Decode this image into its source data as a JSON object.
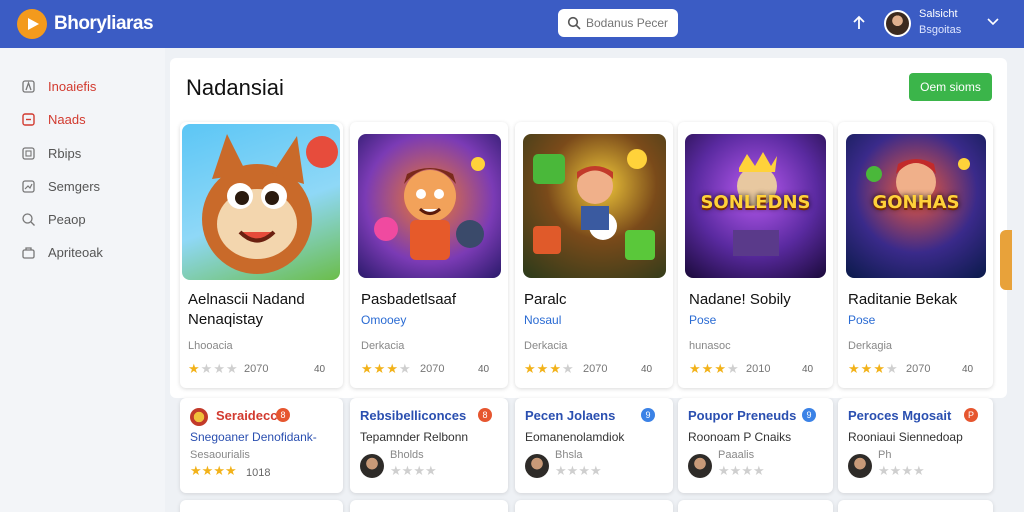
{
  "header": {
    "brand": "Bhoryliaras",
    "search_placeholder": "Bodanus Pecer",
    "user_name": "Salsicht",
    "user_sub": "Bsgoitas",
    "icons": [
      "play-logo-icon",
      "search-icon",
      "upload-icon",
      "chevron-down-icon"
    ]
  },
  "sidebar": {
    "items": [
      {
        "label": "Inoaiefis",
        "icon": "home-icon",
        "active": false
      },
      {
        "label": "Naads",
        "icon": "square-icon",
        "active": true
      },
      {
        "label": "Rbips",
        "icon": "grid-icon",
        "active": false
      },
      {
        "label": "Semgers",
        "icon": "chart-icon",
        "active": false
      },
      {
        "label": "Peaop",
        "icon": "search-icon",
        "active": false
      },
      {
        "label": "Apriteoak",
        "icon": "bag-icon",
        "active": false
      }
    ]
  },
  "main": {
    "title": "Nadansiai",
    "action_label": "Oem sioms",
    "cards": [
      {
        "title_line1": "Aelnascii Nadand",
        "title_line2": "Nenaqistay",
        "subtitle": "",
        "category": "Lhooacia",
        "rating": 1,
        "rating_text": "2070",
        "count": "40",
        "thumb_text": ""
      },
      {
        "title_line1": "Pasbadetlsaaf",
        "title_line2": "",
        "subtitle": "Omooey",
        "category": "Derkacia",
        "rating": 3,
        "rating_text": "2070",
        "count": "40",
        "thumb_text": ""
      },
      {
        "title_line1": "Paralc",
        "title_line2": "",
        "subtitle": "Nosaul",
        "category": "Derkacia",
        "rating": 3,
        "rating_text": "2070",
        "count": "40",
        "thumb_text": ""
      },
      {
        "title_line1": "Nadane! Sobily",
        "title_line2": "",
        "subtitle": "Pose",
        "category": "hunasoc",
        "rating": 3,
        "rating_text": "2010",
        "count": "40",
        "thumb_text": "SONLEDNS"
      },
      {
        "title_line1": "Raditanie Bekak",
        "title_line2": "",
        "subtitle": "Pose",
        "category": "Derkagia",
        "rating": 3,
        "rating_text": "2070",
        "count": "40",
        "thumb_text": "GONHAS"
      }
    ]
  },
  "mini_cards": [
    {
      "title": "Seraidecc",
      "title_color": "#d23a2f",
      "badge_color": "#e6562f",
      "badge": "8",
      "line": "Snegoaner Denofidank-",
      "sub": "Sesaourialis",
      "rating": 4,
      "count": "1018",
      "has_avatar": false
    },
    {
      "title": "Rebsibelliconces",
      "title_color": "#2a4fb0",
      "badge_color": "#e6562f",
      "badge": "8",
      "line": "Tepamnder Relbonn",
      "sub": "Bholds",
      "rating": 0,
      "count": "",
      "has_avatar": true
    },
    {
      "title": "Pecen Jolaens",
      "title_color": "#2a4fb0",
      "badge_color": "#3b82e6",
      "badge": "9",
      "line": "Eomanenolamdiok",
      "sub": "Bhsla",
      "rating": 0,
      "count": "",
      "has_avatar": true
    },
    {
      "title": "Poupor Preneuds",
      "title_color": "#2a4fb0",
      "badge_color": "#3b82e6",
      "badge": "9",
      "line": "Roonoam P Cnaiks",
      "sub": "Paaalis",
      "rating": 0,
      "count": "",
      "has_avatar": true
    },
    {
      "title": "Peroces Mgosait",
      "title_color": "#2a4fb0",
      "badge_color": "#e6562f",
      "badge": "P",
      "line": "Rooniaui Siennedoap",
      "sub": "Ph",
      "rating": 0,
      "count": "",
      "has_avatar": true
    }
  ],
  "colors": {
    "header": "#3b5cc4",
    "accent": "#3bb54a",
    "active": "#d23a2f",
    "star": "#f2b21a"
  }
}
